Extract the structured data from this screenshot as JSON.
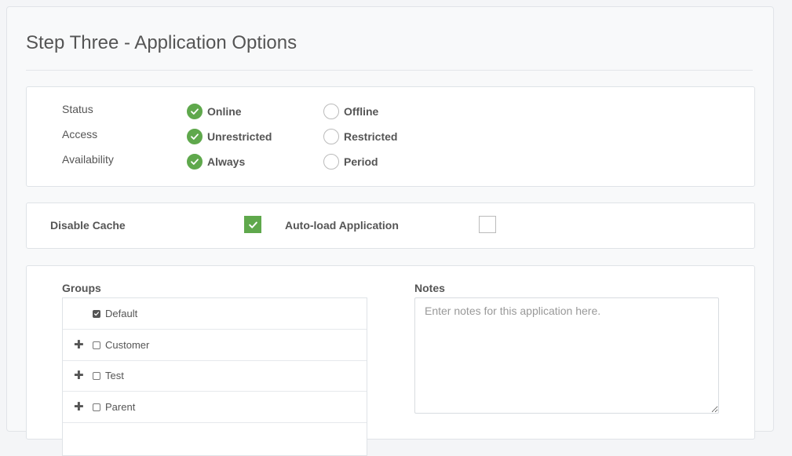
{
  "page": {
    "title": "Step Three - Application Options"
  },
  "options": {
    "rows": [
      {
        "label": "Status",
        "choice_a": "Online",
        "choice_b": "Offline",
        "selected": "a"
      },
      {
        "label": "Access",
        "choice_a": "Unrestricted",
        "choice_b": "Restricted",
        "selected": "a"
      },
      {
        "label": "Availability",
        "choice_a": "Always",
        "choice_b": "Period",
        "selected": "a"
      }
    ]
  },
  "toggles": {
    "disable_cache_label": "Disable Cache",
    "disable_cache_checked": true,
    "autoload_label": "Auto-load Application",
    "autoload_checked": false
  },
  "groups": {
    "label": "Groups",
    "items": [
      {
        "name": "Default",
        "checked": true,
        "expandable": false
      },
      {
        "name": "Customer",
        "checked": false,
        "expandable": true
      },
      {
        "name": "Test",
        "checked": false,
        "expandable": true
      },
      {
        "name": "Parent",
        "checked": false,
        "expandable": true
      }
    ]
  },
  "notes": {
    "label": "Notes",
    "placeholder": "Enter notes for this application here.",
    "value": ""
  },
  "colors": {
    "accent_green": "#5fa84c"
  }
}
